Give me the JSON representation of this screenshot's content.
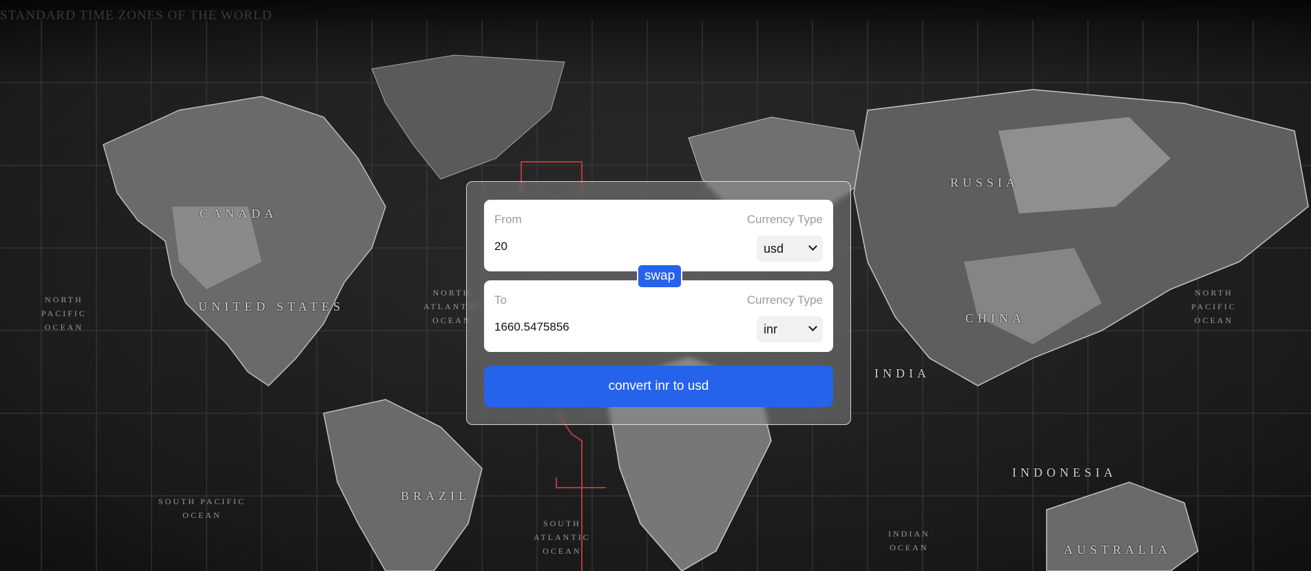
{
  "map": {
    "title": "STANDARD TIME ZONES OF THE WORLD",
    "countries": [
      "CANADA",
      "UNITED STATES",
      "RUSSIA",
      "CHINA",
      "INDIA",
      "BRAZIL",
      "INDONESIA",
      "AUSTRALIA"
    ],
    "oceans": {
      "north_pacific_west": "NORTH\nPACIFIC\nOCEAN",
      "north_atlantic": "NORTH\nATLANTIC\nOCEAN",
      "north_pacific_east": "NORTH\nPACIFIC\nOCEAN",
      "south_pacific": "SOUTH PACIFIC\nOCEAN",
      "south_atlantic": "SOUTH\nATLANTIC\nOCEAN",
      "indian": "INDIAN\nOCEAN"
    }
  },
  "converter": {
    "from": {
      "label": "From",
      "currency_type_label": "Currency Type",
      "amount": "20",
      "currency": "usd"
    },
    "swap_label": "swap",
    "to": {
      "label": "To",
      "currency_type_label": "Currency Type",
      "amount": "1660.5475856",
      "currency": "inr"
    },
    "convert_label": "convert inr to usd"
  },
  "colors": {
    "accent": "#2563eb",
    "card_bg": "rgba(150,150,150,0.45)",
    "field_bg": "#ffffff"
  }
}
